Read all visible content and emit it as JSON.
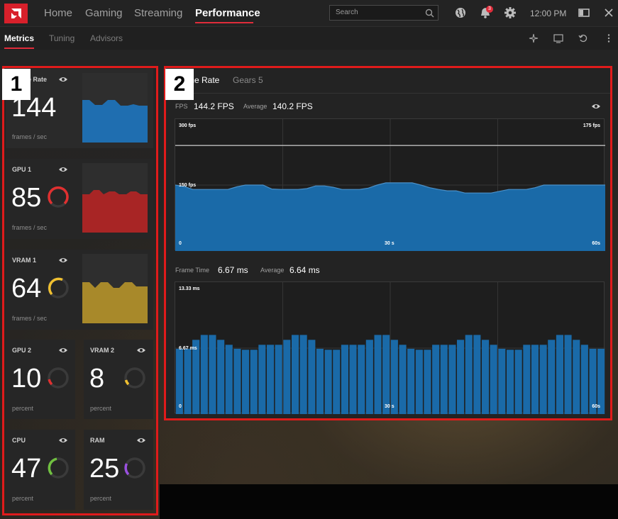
{
  "nav": {
    "items": [
      "Home",
      "Gaming",
      "Streaming",
      "Performance"
    ],
    "search_placeholder": "Search",
    "notification_count": "3",
    "time": "12:00 PM"
  },
  "subtabs": [
    "Metrics",
    "Tuning",
    "Advisors"
  ],
  "tiles": {
    "framerate": {
      "label": "Frame Rate",
      "value": "144",
      "unit": "frames / sec"
    },
    "gpu1": {
      "label": "GPU 1",
      "value": "85",
      "unit": "frames / sec",
      "gauge_color": "#e03030"
    },
    "vram1": {
      "label": "VRAM 1",
      "value": "64",
      "unit": "frames / sec",
      "gauge_color": "#f0c030"
    },
    "gpu2": {
      "label": "GPU 2",
      "value": "10",
      "unit": "percent",
      "gauge_color": "#e03030"
    },
    "vram2": {
      "label": "VRAM 2",
      "value": "8",
      "unit": "percent",
      "gauge_color": "#f0c030"
    },
    "cpu": {
      "label": "CPU",
      "value": "47",
      "unit": "percent",
      "gauge_color": "#70c040"
    },
    "ram": {
      "label": "RAM",
      "value": "25",
      "unit": "percent",
      "gauge_color": "#9a50e0"
    }
  },
  "panel": {
    "tabs": [
      "Frame Rate",
      "Gears 5"
    ],
    "fps_label": "FPS",
    "fps_value": "144.2 FPS",
    "fps_avg_label": "Average",
    "fps_avg_value": "140.2 FPS",
    "ft_label": "Frame Time",
    "ft_value": "6.67 ms",
    "ft_avg_label": "Average",
    "ft_avg_value": "6.64 ms"
  },
  "chart_data": [
    {
      "type": "area",
      "title": "FPS",
      "y_top_label": "300 fps",
      "y_right_label": "175 fps",
      "y_mid_label": "150 fps",
      "x_labels": [
        "0",
        "30 s",
        "60s"
      ],
      "ylim": [
        0,
        300
      ],
      "reference_line": 240,
      "color": "#1a6aa8",
      "values": [
        150,
        147,
        140,
        140,
        140,
        140,
        140,
        146,
        150,
        150,
        150,
        141,
        140,
        140,
        140,
        142,
        148,
        148,
        145,
        140,
        140,
        140,
        143,
        150,
        155,
        155,
        155,
        155,
        150,
        144,
        140,
        137,
        137,
        132,
        132,
        132,
        132,
        136,
        140,
        140,
        140,
        144,
        150,
        150,
        150,
        150,
        150,
        150,
        150,
        150
      ]
    },
    {
      "type": "bar",
      "title": "Frame Time",
      "y_top_label": "13.33 ms",
      "y_mid_label": "6.67 ms",
      "x_labels": [
        "0",
        "30 s",
        "60s"
      ],
      "ylim": [
        0,
        13.33
      ],
      "color": "#1a6aa8",
      "values": [
        6.6,
        6.6,
        7.5,
        8.0,
        8.0,
        7.5,
        7.0,
        6.6,
        6.5,
        6.5,
        7.0,
        7.0,
        7.0,
        7.5,
        8.0,
        8.0,
        7.5,
        6.6,
        6.5,
        6.5,
        7.0,
        7.0,
        7.0,
        7.5,
        8.0,
        8.0,
        7.5,
        7.0,
        6.6,
        6.5,
        6.5,
        7.0,
        7.0,
        7.0,
        7.5,
        8.0,
        8.0,
        7.5,
        7.0,
        6.6,
        6.5,
        6.5,
        7.0,
        7.0,
        7.0,
        7.5,
        8.0,
        8.0,
        7.5,
        7.0,
        6.6,
        6.6
      ]
    }
  ],
  "annotations": [
    "1",
    "2"
  ]
}
